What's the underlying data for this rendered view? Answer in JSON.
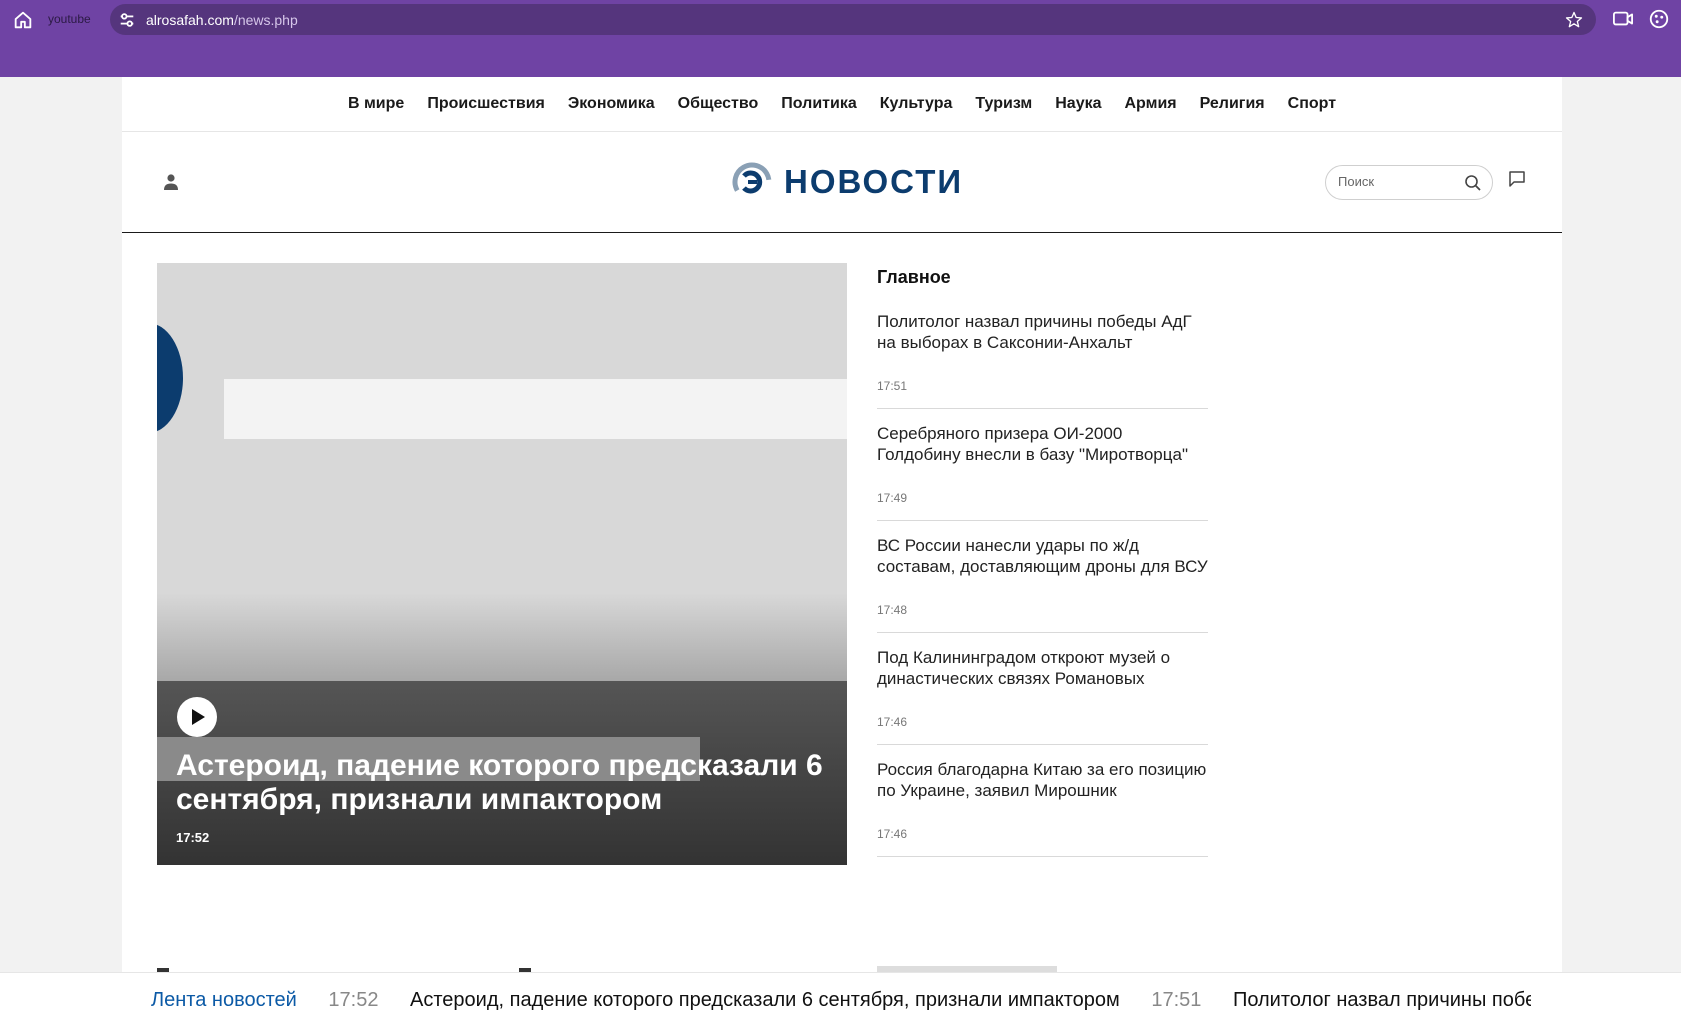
{
  "browser": {
    "tab_label": "youtube",
    "url_domain": "alrosafah.com",
    "url_path": "/news.php"
  },
  "nav": [
    "В мире",
    "Происшествия",
    "Экономика",
    "Общество",
    "Политика",
    "Культура",
    "Туризм",
    "Наука",
    "Армия",
    "Религия",
    "Спорт"
  ],
  "header": {
    "logo_text": "НОВОСТИ",
    "search_placeholder": "Поиск"
  },
  "hero": {
    "title": "Астероид, падение которого предсказали 6 сентября, признали импактором",
    "time": "17:52"
  },
  "main": {
    "heading": "Главное",
    "items": [
      {
        "title": "Политолог назвал причины победы АдГ на выборах в Саксонии-Анхальт",
        "time": "17:51"
      },
      {
        "title": "Серебряного призера ОИ-2000 Голдобину внесли в базу \"Миротворца\"",
        "time": "17:49"
      },
      {
        "title": "ВС России нанесли удары по ж/д составам, доставляющим дроны для ВСУ",
        "time": "17:48"
      },
      {
        "title": "Под Калининградом откроют музей о династических связях Романовых",
        "time": "17:46"
      },
      {
        "title": "Россия благодарна Китаю за его позицию по Украине, заявил Мирошник",
        "time": "17:46"
      }
    ]
  },
  "ticker": {
    "label": "Лента новостей",
    "items": [
      {
        "time": "17:52",
        "text": "Астероид, падение которого предсказали 6 сентября, признали импактором"
      },
      {
        "time": "17:51",
        "text": "Политолог назвал причины победы АдГ на выборах в Саксонии-Анхальт"
      }
    ]
  },
  "colors": {
    "browser_bar": "#6f43a4",
    "brand": "#0c3c6e",
    "ticker_label": "#0c5aa6"
  },
  "icons": [
    "home-icon",
    "site-info-icon",
    "bookmark-star-icon",
    "cast-icon",
    "extensions-icon",
    "user-icon",
    "search-icon",
    "comment-icon",
    "play-icon"
  ]
}
